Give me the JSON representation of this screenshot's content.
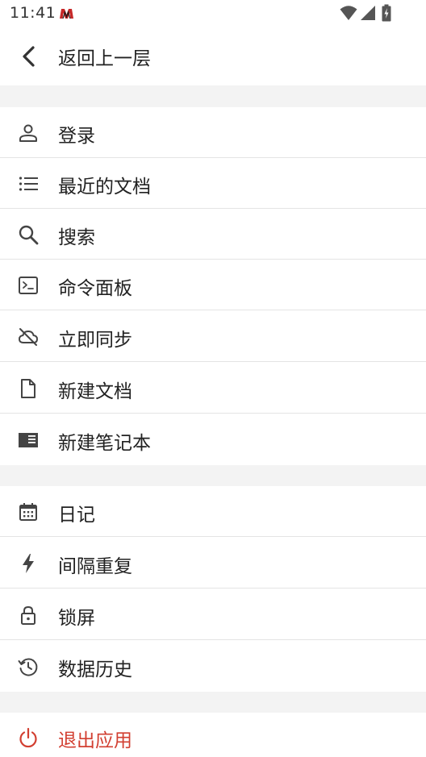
{
  "status_bar": {
    "time": "11:41",
    "app_icon": "app-logo-icon",
    "icons": [
      "wifi-icon",
      "signal-icon",
      "battery-icon"
    ]
  },
  "header": {
    "back_icon": "chevron-left-icon",
    "title": "返回上一层"
  },
  "menu": {
    "group1": [
      {
        "icon": "user-icon",
        "label": "登录"
      },
      {
        "icon": "list-icon",
        "label": "最近的文档"
      },
      {
        "icon": "search-icon",
        "label": "搜索"
      },
      {
        "icon": "terminal-icon",
        "label": "命令面板"
      },
      {
        "icon": "cloud-off-icon",
        "label": "立即同步"
      },
      {
        "icon": "file-icon",
        "label": "新建文档"
      },
      {
        "icon": "notebook-icon",
        "label": "新建笔记本"
      }
    ],
    "group2": [
      {
        "icon": "calendar-icon",
        "label": "日记"
      },
      {
        "icon": "bolt-icon",
        "label": "间隔重复"
      },
      {
        "icon": "lock-icon",
        "label": "锁屏"
      },
      {
        "icon": "history-icon",
        "label": "数据历史"
      }
    ],
    "group3": [
      {
        "icon": "power-icon",
        "label": "退出应用"
      }
    ]
  },
  "colors": {
    "background": "#ffffff",
    "separator": "#f3f3f3",
    "divider": "#e4e4e4",
    "text": "#222222",
    "icon": "#444444",
    "danger": "#d23f31"
  }
}
